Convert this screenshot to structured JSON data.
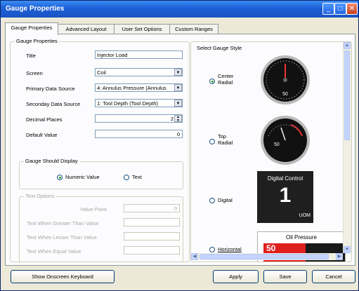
{
  "window": {
    "title": "Gauge Properties"
  },
  "tabs": [
    {
      "label": "Gauge Properties"
    },
    {
      "label": "Advanced Layout"
    },
    {
      "label": "User Set Options"
    },
    {
      "label": "Custom Ranges"
    }
  ],
  "gauge_properties": {
    "group_label": "Gauge Properties",
    "title": {
      "label": "Title",
      "value": "Injector Load"
    },
    "screen": {
      "label": "Screen",
      "value": "Coil"
    },
    "primary_source": {
      "label": "Primary Data Source",
      "value": "4: Annulus Pressure (Annulus"
    },
    "secondary_source": {
      "label": "Seconday Data Source",
      "value": "1: Tool Depth (Tool Depth)"
    },
    "decimal_places": {
      "label": "Decimal Places",
      "value": "2"
    },
    "default_value": {
      "label": "Default Value",
      "value": "0"
    }
  },
  "gauge_display": {
    "group_label": "Gauge Should Display",
    "numeric_label": "Numeric Value",
    "text_label": "Text",
    "selected": "numeric"
  },
  "text_options": {
    "group_label": "Text Options",
    "value_point": {
      "label": "Value Point",
      "value": "0"
    },
    "greater": {
      "label": "Text When Greater Than Value"
    },
    "lesser": {
      "label": "Text When Lesser Than Value"
    },
    "equal": {
      "label": "Text When Equal Value"
    }
  },
  "styles": {
    "group_label": "Select Gauge Style",
    "items": [
      {
        "label_line1": "Center",
        "label_line2": "Radial",
        "selected": true,
        "preview_value": "50"
      },
      {
        "label_line1": "Top",
        "label_line2": "Radial",
        "selected": false,
        "preview_value": "50"
      },
      {
        "label": "Digital",
        "selected": false,
        "preview_title": "Digital Control",
        "preview_value": "1",
        "preview_unit": "UOM"
      },
      {
        "label": "Horizontal",
        "selected": false,
        "preview_title": "Oil Pressure",
        "preview_value": "50"
      }
    ]
  },
  "footer": {
    "keyboard_label": "Show Onscreen Keyboard",
    "apply_label": "Apply",
    "save_label": "Save",
    "cancel_label": "Cancel"
  }
}
